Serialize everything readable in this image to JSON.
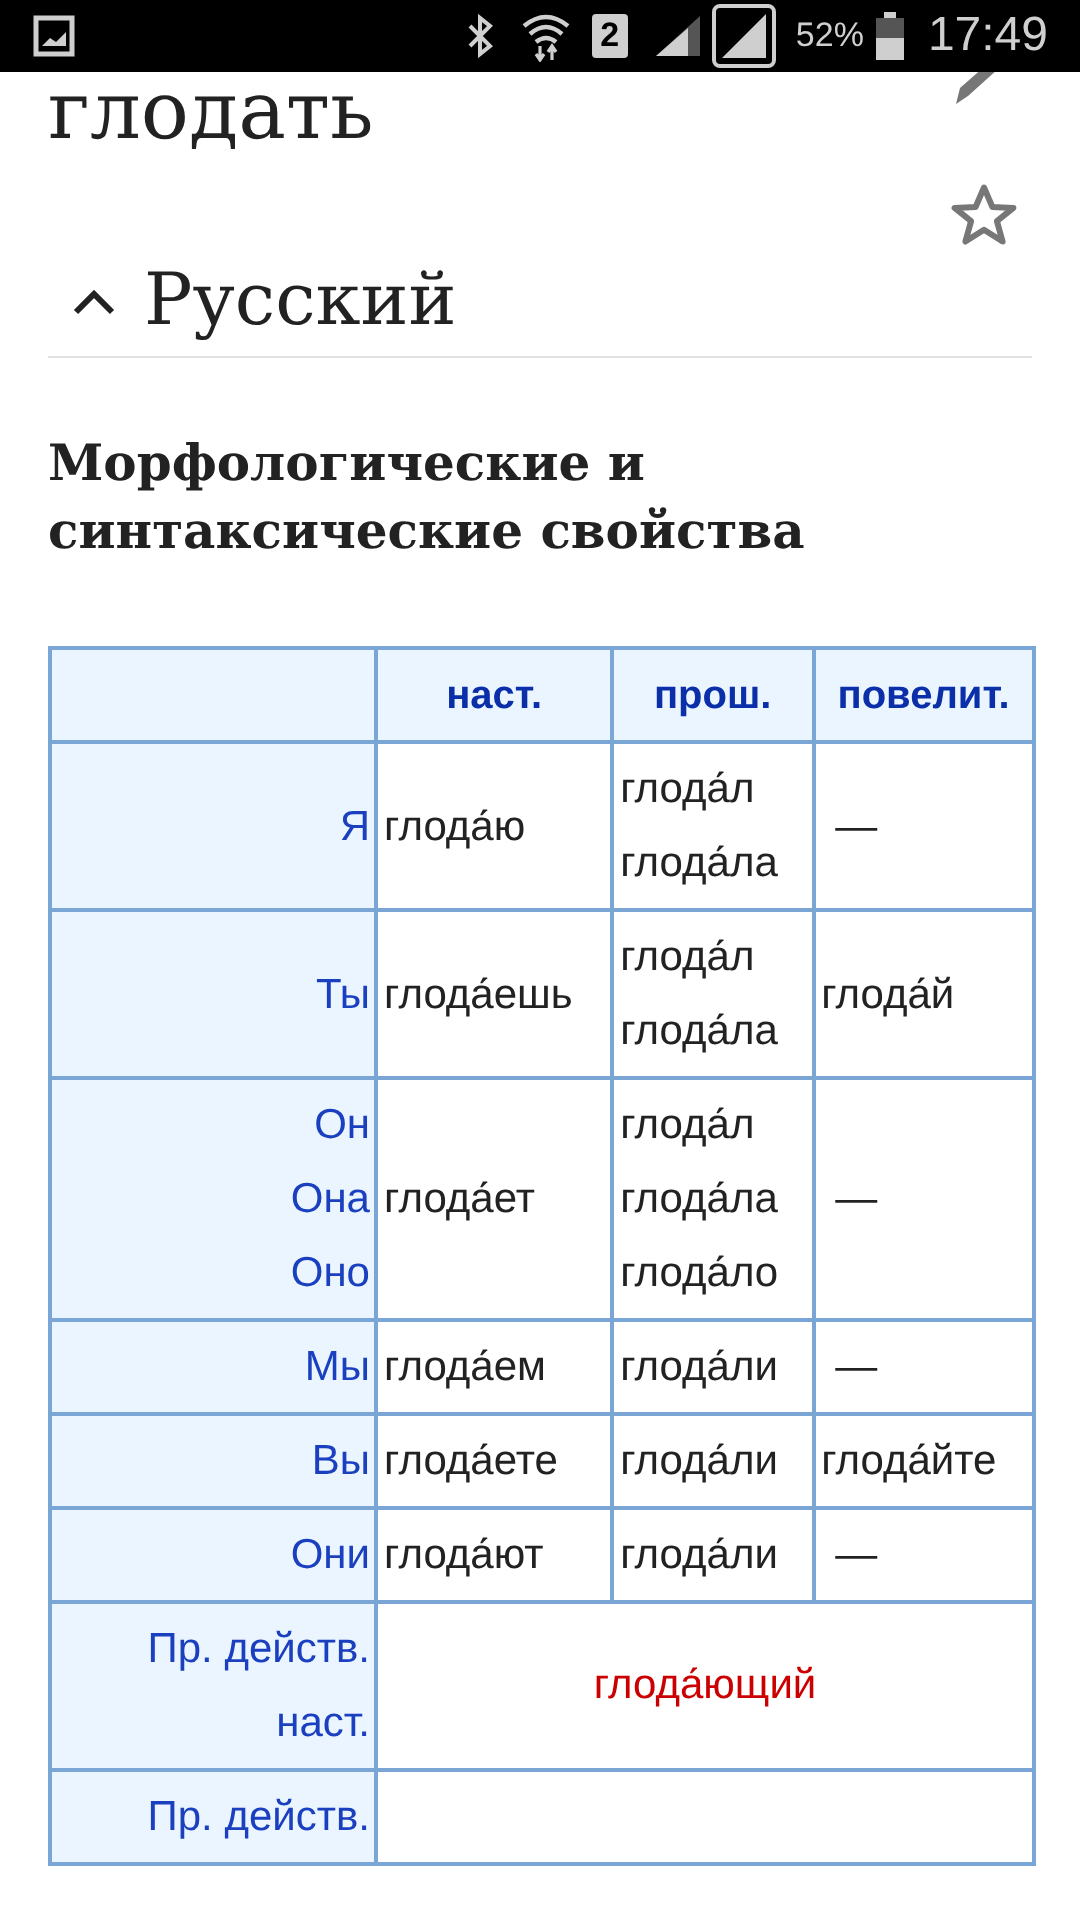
{
  "status_bar": {
    "sim_slot": "2",
    "battery": "52%",
    "time": "17:49"
  },
  "page_title": "глодать",
  "section": {
    "title": "Русский",
    "expanded": true
  },
  "subheading": "Морфологические и синтаксические свойства",
  "table": {
    "columns": [
      "наст.",
      "прош.",
      "повелит."
    ],
    "rows": [
      {
        "kind": "forms",
        "label": [
          "Я"
        ],
        "cells": [
          [
            "глода́ю"
          ],
          [
            "глода́л",
            "глода́ла"
          ],
          [
            "—"
          ]
        ]
      },
      {
        "kind": "forms",
        "label": [
          "Ты"
        ],
        "cells": [
          [
            "глода́ешь"
          ],
          [
            "глода́л",
            "глода́ла"
          ],
          [
            "глода́й"
          ]
        ]
      },
      {
        "kind": "forms",
        "label": [
          "Он",
          "Она",
          "Оно"
        ],
        "cells": [
          [
            "глода́ет"
          ],
          [
            "глода́л",
            "глода́ла",
            "глода́ло"
          ],
          [
            "—"
          ]
        ]
      },
      {
        "kind": "forms",
        "label": [
          "Мы"
        ],
        "cells": [
          [
            "глода́ем"
          ],
          [
            "глода́ли"
          ],
          [
            "—"
          ]
        ]
      },
      {
        "kind": "forms",
        "label": [
          "Вы"
        ],
        "cells": [
          [
            "глода́ете"
          ],
          [
            "глода́ли"
          ],
          [
            "глода́йте"
          ]
        ]
      },
      {
        "kind": "forms",
        "label": [
          "Они"
        ],
        "cells": [
          [
            "глода́ют"
          ],
          [
            "глода́ли"
          ],
          [
            "—"
          ]
        ]
      },
      {
        "kind": "participle",
        "label": [
          "Пр. действ.",
          "наст."
        ],
        "value": "глода́ющий"
      },
      {
        "kind": "participle",
        "label": [
          "Пр. действ."
        ]
      }
    ]
  }
}
